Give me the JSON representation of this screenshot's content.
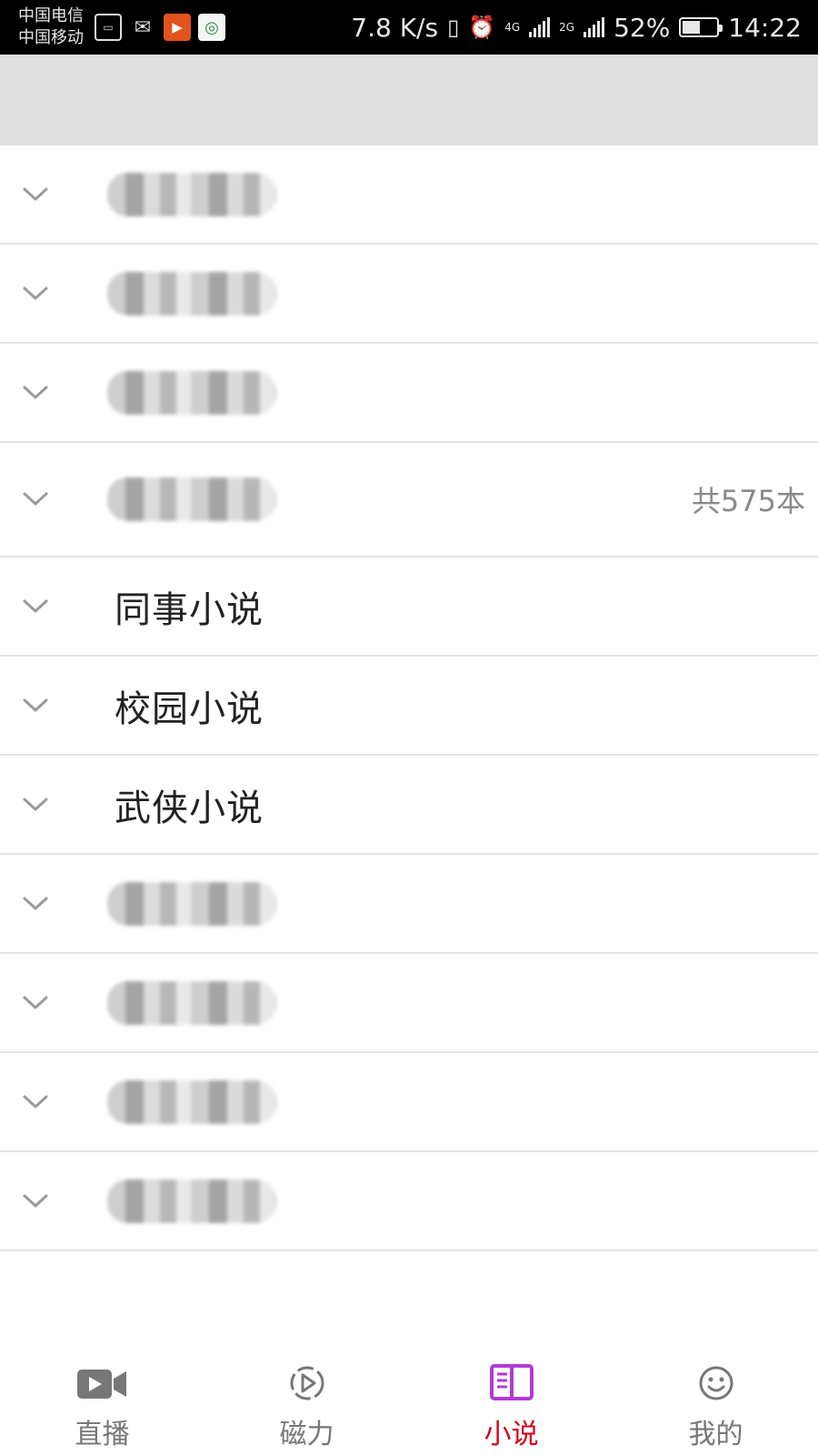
{
  "status_bar": {
    "carrier_1": "中国电信",
    "carrier_2": "中国移动",
    "speed": "7.8 K/s",
    "net_4g": "4G",
    "net_2g": "2G",
    "battery_pct": "52%",
    "battery_level": 0.52,
    "time": "14:22"
  },
  "list": {
    "rows": [
      {
        "label": "",
        "redacted": true
      },
      {
        "label": "",
        "redacted": true
      },
      {
        "label": "",
        "redacted": true
      },
      {
        "label": "",
        "redacted": true,
        "count": "共575本"
      },
      {
        "label": "同事小说",
        "redacted": false
      },
      {
        "label": "校园小说",
        "redacted": false
      },
      {
        "label": "武侠小说",
        "redacted": false
      },
      {
        "label": "",
        "redacted": true
      },
      {
        "label": "",
        "redacted": true
      },
      {
        "label": "",
        "redacted": true
      },
      {
        "label": "",
        "redacted": true
      }
    ]
  },
  "bottom_nav": {
    "tabs": [
      {
        "label": "直播",
        "icon": "video-camera-icon",
        "active": false
      },
      {
        "label": "磁力",
        "icon": "play-circle-icon",
        "active": false
      },
      {
        "label": "小说",
        "icon": "book-icon",
        "active": true
      },
      {
        "label": "我的",
        "icon": "smiley-icon",
        "active": false
      }
    ],
    "active_color": "#d0021b",
    "book_icon_color": "#b23ad6"
  }
}
